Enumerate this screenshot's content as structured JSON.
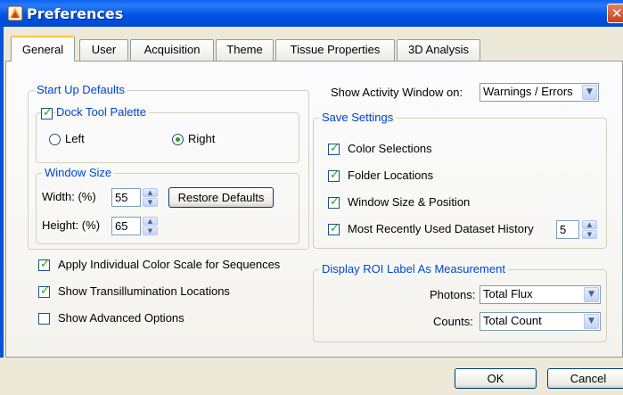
{
  "window": {
    "title": "Preferences",
    "close_label": "✕"
  },
  "tabs": [
    "General",
    "User",
    "Acquisition",
    "Theme",
    "Tissue Properties",
    "3D Analysis"
  ],
  "startup": {
    "legend": "Start Up Defaults",
    "dock_label": "Dock Tool Palette",
    "left_label": "Left",
    "right_label": "Right",
    "window_size": {
      "legend": "Window Size",
      "width_label": "Width: (%)",
      "width_value": "55",
      "height_label": "Height: (%)",
      "height_value": "65",
      "restore_label": "Restore Defaults"
    }
  },
  "general_options": [
    {
      "label": "Apply Individual Color Scale for Sequences",
      "checked": true
    },
    {
      "label": "Show Transillumination Locations",
      "checked": true
    },
    {
      "label": "Show Advanced Options",
      "checked": false
    }
  ],
  "activity": {
    "label": "Show Activity Window on:",
    "value": "Warnings / Errors"
  },
  "save_settings": {
    "legend": "Save Settings",
    "color_selections": "Color Selections",
    "folder_locations": "Folder Locations",
    "window_size_position": "Window Size & Position",
    "mru_history": "Most Recently Used Dataset History",
    "mru_value": "5"
  },
  "roi": {
    "legend": "Display ROI Label As Measurement",
    "photons_label": "Photons:",
    "photons_value": "Total Flux",
    "counts_label": "Counts:",
    "counts_value": "Total Count"
  },
  "footer": {
    "ok_label": "OK",
    "cancel_label": "Cancel"
  },
  "colors": {
    "titlebar": "#0055e5",
    "legend_text": "#0046d5",
    "check": "#21a121",
    "dialog_bg": "#ece9d8"
  }
}
